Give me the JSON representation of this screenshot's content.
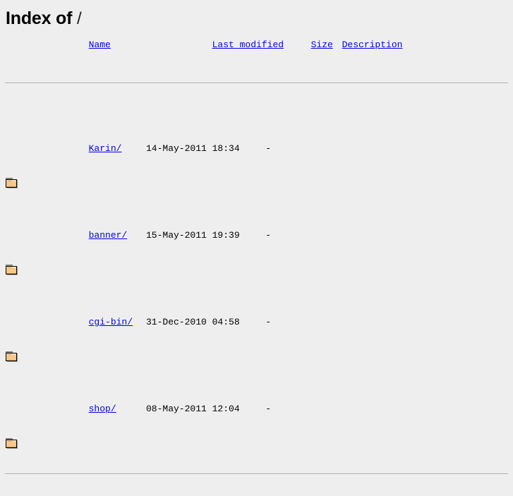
{
  "page": {
    "title_prefix": "Index of ",
    "title_path": "/",
    "background_color": "#eeeeee",
    "link_color": "#0000ee",
    "text_color": "#000000",
    "rule_color": "#a9a9a9"
  },
  "columns": [
    {
      "key": "icon",
      "label": "",
      "sortable": false
    },
    {
      "key": "name",
      "label": "Name",
      "sortable": true
    },
    {
      "key": "last_modified",
      "label": "Last modified",
      "sortable": true
    },
    {
      "key": "size",
      "label": "Size",
      "sortable": true
    },
    {
      "key": "description",
      "label": "Description",
      "sortable": true
    }
  ],
  "entries": [
    {
      "icon": "folder-icon",
      "name": "Karin/",
      "last_modified": "14-May-2011 18:34",
      "size": "-",
      "description": ""
    },
    {
      "icon": "folder-icon",
      "name": "banner/",
      "last_modified": "15-May-2011 19:39",
      "size": "-",
      "description": ""
    },
    {
      "icon": "folder-icon",
      "name": "cgi-bin/",
      "last_modified": "31-Dec-2010 04:58",
      "size": "-",
      "description": ""
    },
    {
      "icon": "folder-icon",
      "name": "shop/",
      "last_modified": "08-May-2011 12:04",
      "size": "-",
      "description": ""
    }
  ]
}
